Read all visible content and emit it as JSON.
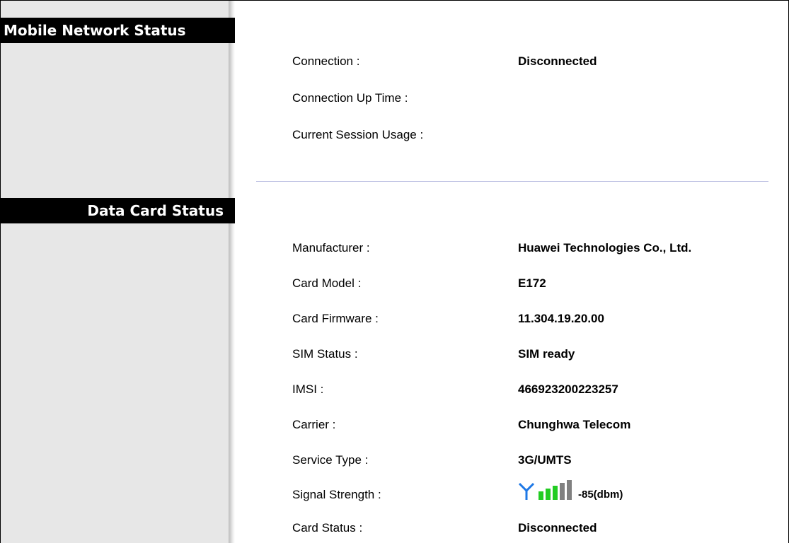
{
  "mobile_network": {
    "header": "Mobile Network Status",
    "rows": [
      {
        "label": "Connection :",
        "value": "Disconnected"
      },
      {
        "label": "Connection Up Time :",
        "value": ""
      },
      {
        "label": "Current Session Usage :",
        "value": ""
      }
    ]
  },
  "data_card": {
    "header": "Data Card Status",
    "rows": [
      {
        "label": "Manufacturer :",
        "value": "Huawei Technologies Co., Ltd."
      },
      {
        "label": "Card Model :",
        "value": "E172"
      },
      {
        "label": "Card Firmware :",
        "value": "11.304.19.20.00"
      },
      {
        "label": "SIM Status :",
        "value": "SIM ready"
      },
      {
        "label": "IMSI :",
        "value": "466923200223257"
      },
      {
        "label": "Carrier :",
        "value": "Chunghwa Telecom"
      },
      {
        "label": "Service Type :",
        "value": "3G/UMTS"
      },
      {
        "label": "Signal Strength :",
        "value": "-85(dbm)"
      },
      {
        "label": "Card Status :",
        "value": "Disconnected"
      }
    ],
    "signal": {
      "icon": "antenna-icon",
      "bars_total": 5,
      "bars_active": 3,
      "active_color": "#22cc22",
      "inactive_color": "#808080",
      "antenna_color": "#1e78e6"
    }
  }
}
